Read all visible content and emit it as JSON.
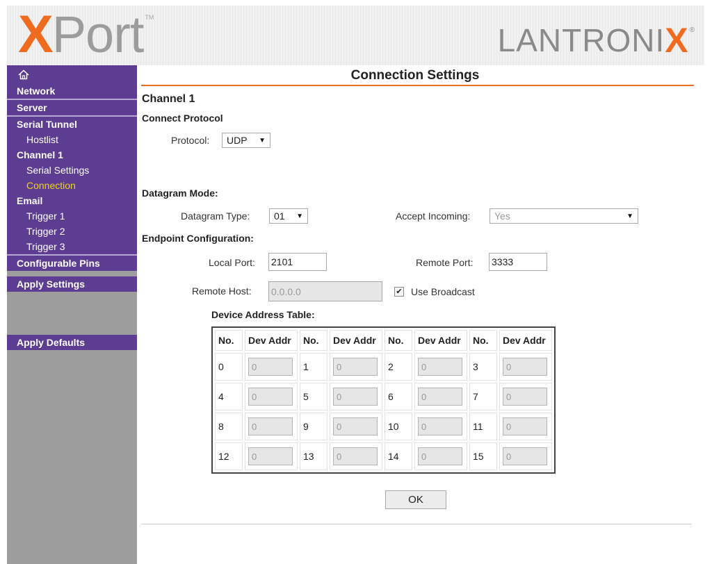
{
  "header": {
    "logo_left_x": "X",
    "logo_left_rest": "Port",
    "logo_left_tm": "TM",
    "logo_right_main": "LANTRONI",
    "logo_right_accent": "X",
    "logo_right_reg": "®"
  },
  "colors": {
    "brand_orange": "#ef6b1f",
    "nav_purple": "#5d3d92",
    "active_nav": "#f2d21a",
    "sidebar_gray": "#9d9d9d"
  },
  "sidebar": {
    "home_icon": "home-icon",
    "network": "Network",
    "server": "Server",
    "serial_tunnel": "Serial Tunnel",
    "hostlist": "Hostlist",
    "channel1": "Channel 1",
    "serial_settings": "Serial Settings",
    "connection": "Connection",
    "email": "Email",
    "trigger1": "Trigger 1",
    "trigger2": "Trigger 2",
    "trigger3": "Trigger 3",
    "configurable_pins": "Configurable Pins",
    "apply_settings": "Apply Settings",
    "apply_defaults": "Apply Defaults"
  },
  "main": {
    "title": "Connection Settings",
    "channel": "Channel 1",
    "connect_protocol": "Connect Protocol",
    "protocol_label": "Protocol:",
    "protocol_value": "UDP",
    "datagram_mode": "Datagram Mode:",
    "datagram_type_label": "Datagram Type:",
    "datagram_type_value": "01",
    "accept_incoming_label": "Accept Incoming:",
    "accept_incoming_value": "Yes",
    "endpoint_config": "Endpoint Configuration:",
    "local_port_label": "Local Port:",
    "local_port_value": "2101",
    "remote_port_label": "Remote Port:",
    "remote_port_value": "3333",
    "remote_host_label": "Remote Host:",
    "remote_host_value": "0.0.0.0",
    "use_broadcast_label": "Use Broadcast",
    "use_broadcast_checked": true,
    "device_table_title": "Device Address Table:",
    "table_header_no": "No.",
    "table_header_addr": "Dev Addr",
    "rows": [
      [
        {
          "no": "0",
          "addr": "0"
        },
        {
          "no": "1",
          "addr": "0"
        },
        {
          "no": "2",
          "addr": "0"
        },
        {
          "no": "3",
          "addr": "0"
        }
      ],
      [
        {
          "no": "4",
          "addr": "0"
        },
        {
          "no": "5",
          "addr": "0"
        },
        {
          "no": "6",
          "addr": "0"
        },
        {
          "no": "7",
          "addr": "0"
        }
      ],
      [
        {
          "no": "8",
          "addr": "0"
        },
        {
          "no": "9",
          "addr": "0"
        },
        {
          "no": "10",
          "addr": "0"
        },
        {
          "no": "11",
          "addr": "0"
        }
      ],
      [
        {
          "no": "12",
          "addr": "0"
        },
        {
          "no": "13",
          "addr": "0"
        },
        {
          "no": "14",
          "addr": "0"
        },
        {
          "no": "15",
          "addr": "0"
        }
      ]
    ],
    "ok_label": "OK"
  }
}
